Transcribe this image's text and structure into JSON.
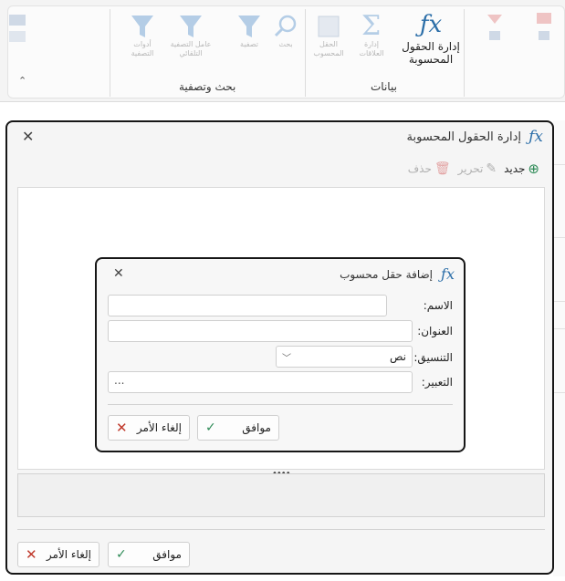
{
  "ribbon": {
    "calc_fields_label": "إدارة الحقول\nالمحسوبة",
    "group_data_label": "بيانات",
    "group_search_label": "بحث وتصفية",
    "faded_buttons": [
      "أدوات\nالتصفية",
      "عامل التصفية\nالتلقائي",
      "تصفية",
      "بحث",
      "الحقل\nالمحسوب",
      "إدارة\nالعلاقات"
    ],
    "collapse_glyph": "⌃"
  },
  "outer_dialog": {
    "title": "إدارة الحقول المحسوبة",
    "toolbar": {
      "new_label": "جديد",
      "edit_label": "تحرير",
      "delete_label": "حذف"
    },
    "ok_label": "موافق",
    "cancel_label": "إلغاء الأمر",
    "splitter_glyph": "••••"
  },
  "inner_dialog": {
    "title": "إضافة حقل محسوب",
    "name_label": "الاسم:",
    "name_value": "",
    "caption_label": "العنوان:",
    "caption_value": "",
    "format_label": "التنسيق:",
    "format_value": "نص",
    "expression_label": "التعبير:",
    "expression_value": "...",
    "ok_label": "موافق",
    "cancel_label": "إلغاء الأمر"
  },
  "colors": {
    "accent_blue": "#2b6ea8",
    "ok_green": "#2e8b57",
    "cancel_red": "#c0392b"
  }
}
